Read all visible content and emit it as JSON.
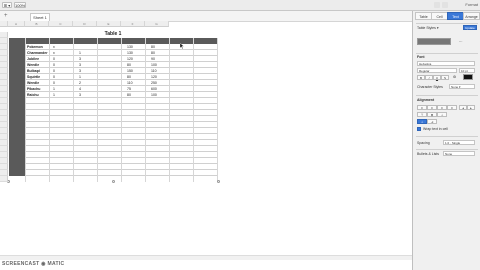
{
  "toolbar": {
    "btn1": "⊞ ▾",
    "btn2": "100% ▾",
    "right_label": "Format"
  },
  "sheet_tabs": [
    {
      "label": "Sheet 1"
    }
  ],
  "column_headers": [
    "",
    "A",
    "B",
    "C",
    "D",
    "E",
    "F",
    "G"
  ],
  "table": {
    "title": "Table 1",
    "rows": [
      [
        "Pokemon",
        "x",
        "",
        "",
        "130",
        "80"
      ],
      [
        "Charmander",
        "x",
        "1",
        "",
        "130",
        "80"
      ],
      [
        "Jubilee",
        "0",
        "3",
        "",
        "120",
        "90"
      ],
      [
        "Weedle",
        "0",
        "3",
        "",
        "80",
        "100"
      ],
      [
        "Bulbapi",
        "0",
        "3",
        "",
        "150",
        "110"
      ],
      [
        "Squirtle",
        "0",
        "1",
        "",
        "80",
        "120"
      ],
      [
        "Weedle",
        "0",
        "2",
        "",
        "110",
        "250"
      ],
      [
        "Pikachu",
        "1",
        "4",
        "",
        "75",
        "600"
      ],
      [
        "Raichu",
        "1",
        "3",
        "",
        "80",
        "100"
      ],
      [
        "",
        "",
        "",
        "",
        "",
        ""
      ],
      [
        "",
        "",
        "",
        "",
        "",
        ""
      ],
      [
        "",
        "",
        "",
        "",
        "",
        ""
      ],
      [
        "",
        "",
        "",
        "",
        "",
        ""
      ],
      [
        "",
        "",
        "",
        "",
        "",
        ""
      ],
      [
        "",
        "",
        "",
        "",
        "",
        ""
      ],
      [
        "",
        "",
        "",
        "",
        "",
        ""
      ],
      [
        "",
        "",
        "",
        "",
        "",
        ""
      ],
      [
        "",
        "",
        "",
        "",
        "",
        ""
      ],
      [
        "",
        "",
        "",
        "",
        "",
        ""
      ],
      [
        "",
        "",
        "",
        "",
        "",
        ""
      ],
      [
        "",
        "",
        "",
        "",
        "",
        ""
      ],
      [
        "",
        "",
        "",
        "",
        "",
        ""
      ]
    ]
  },
  "panel": {
    "tabs": [
      "Table",
      "Cell",
      "Text",
      "Arrange"
    ],
    "active_tab": 2,
    "style_label": "Table Styles ▾",
    "style_button": "Update",
    "font_label": "Font",
    "font_name": "Helvetica",
    "font_style": "Regular",
    "font_size": "10 pt",
    "char_styles_label": "Character Styles",
    "char_styles_value": "None ▾",
    "alignment_label": "Alignment",
    "wrap_label": "Wrap text in cell",
    "spacing_label": "Spacing",
    "spacing_value": "1.0 · Single",
    "bullets_label": "Bullets & Lists",
    "bullets_value": "None"
  },
  "watermark": "SCREENCAST ◉ MATIC",
  "colors": {
    "accent": "#3a78d8",
    "header_dark": "#5a5a5a"
  }
}
